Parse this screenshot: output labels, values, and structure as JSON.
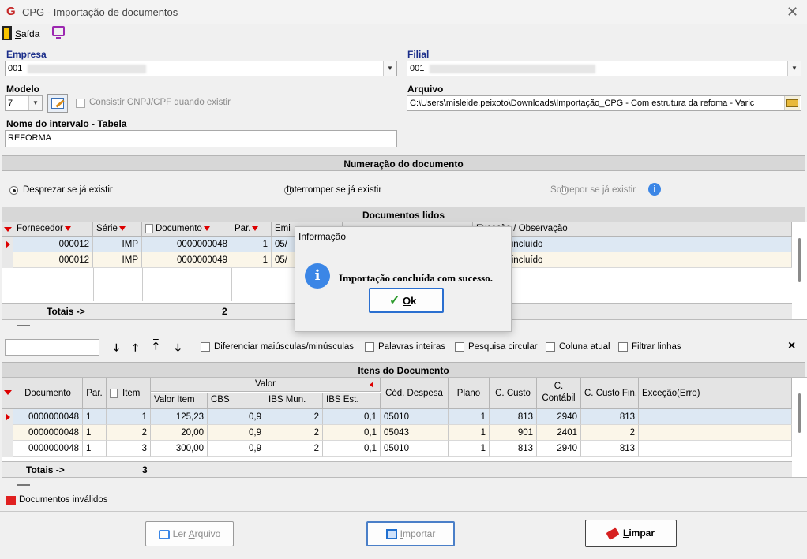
{
  "window": {
    "title": "CPG - Importação de documentos",
    "logo": "G",
    "close_glyph": "✕"
  },
  "menu": {
    "saida_first": "S",
    "saida_rest": "aída"
  },
  "form": {
    "empresa_label": "Empresa",
    "empresa_value": "001",
    "filial_label": "Filial",
    "filial_value": "001",
    "modelo_label": "Modelo",
    "modelo_value": "7",
    "consistir_label": "Consistir CNPJ/CPF quando existir",
    "arquivo_label": "Arquivo",
    "arquivo_value": "C:\\Users\\misleide.peixoto\\Downloads\\Importação_CPG - Com estrutura da refoma - Varic",
    "intervalo_label": "Nome do intervalo - Tabela",
    "intervalo_value": "REFORMA"
  },
  "numeracao": {
    "header": "Numeração do documento",
    "options": [
      "Desprezar se já existir",
      "Interromper se já existir",
      "Sobrepor se já existir"
    ]
  },
  "docs_lidos": {
    "header": "Documentos lidos",
    "columns": [
      "Fornecedor",
      "Série",
      "Documento",
      "Par.",
      "Emi",
      "Exceção / Observação"
    ],
    "rows": [
      {
        "fornecedor": "000012",
        "serie": "IMP",
        "documento": "0000000048",
        "par": "1",
        "emi": "05/",
        "obs": "nto será incluído"
      },
      {
        "fornecedor": "000012",
        "serie": "IMP",
        "documento": "0000000049",
        "par": "1",
        "emi": "05/",
        "obs": "nto será incluído"
      }
    ],
    "totals_label": "Totais ->",
    "totals_value": "2"
  },
  "search_bar": {
    "diferenciar": "Diferenciar maiúsculas/minúsculas",
    "palavras": "Palavras inteiras",
    "circular": "Pesquisa circular",
    "coluna": "Coluna atual",
    "filtrar": "Filtrar linhas",
    "close": "×"
  },
  "itens": {
    "header": "Itens do Documento",
    "group_valor": "Valor",
    "columns": {
      "documento": "Documento",
      "par": "Par.",
      "item": "Item",
      "valor_item": "Valor Item",
      "cbs": "CBS",
      "ibs_mun": "IBS Mun.",
      "ibs_est": "IBS Est.",
      "cod_despesa": "Cód. Despesa",
      "plano": "Plano",
      "c_custo": "C. Custo",
      "c_contabil_1": "C.",
      "c_contabil_2": "Contábil",
      "c_custo_fin": "C. Custo Fin.",
      "excecao": "Exceção(Erro)"
    },
    "rows": [
      {
        "documento": "0000000048",
        "par": "1",
        "item": "1",
        "valor_item": "125,23",
        "cbs": "0,9",
        "ibs_mun": "2",
        "ibs_est": "0,1",
        "cod_despesa": "05010",
        "plano": "1",
        "c_custo": "813",
        "c_contabil": "2940",
        "c_custo_fin": "813"
      },
      {
        "documento": "0000000048",
        "par": "1",
        "item": "2",
        "valor_item": "20,00",
        "cbs": "0,9",
        "ibs_mun": "2",
        "ibs_est": "0,1",
        "cod_despesa": "05043",
        "plano": "1",
        "c_custo": "901",
        "c_contabil": "2401",
        "c_custo_fin": "2"
      },
      {
        "documento": "0000000048",
        "par": "1",
        "item": "3",
        "valor_item": "300,00",
        "cbs": "0,9",
        "ibs_mun": "2",
        "ibs_est": "0,1",
        "cod_despesa": "05010",
        "plano": "1",
        "c_custo": "813",
        "c_contabil": "2940",
        "c_custo_fin": "813"
      }
    ],
    "totals_label": "Totais ->",
    "totals_value": "3"
  },
  "legend": {
    "invalid_label": "Documentos inválidos",
    "invalid_color": "#e02020"
  },
  "buttons": {
    "ler_pre": "Ler ",
    "ler_u": "A",
    "ler_post": "rquivo",
    "importar_u": "I",
    "importar_post": "mportar",
    "limpar_u": "L",
    "limpar_post": "impar"
  },
  "dialog": {
    "title": "Informação",
    "message": "Importação concluída com sucesso.",
    "ok_u": "O",
    "ok_post": "k",
    "info_glyph": "i"
  }
}
